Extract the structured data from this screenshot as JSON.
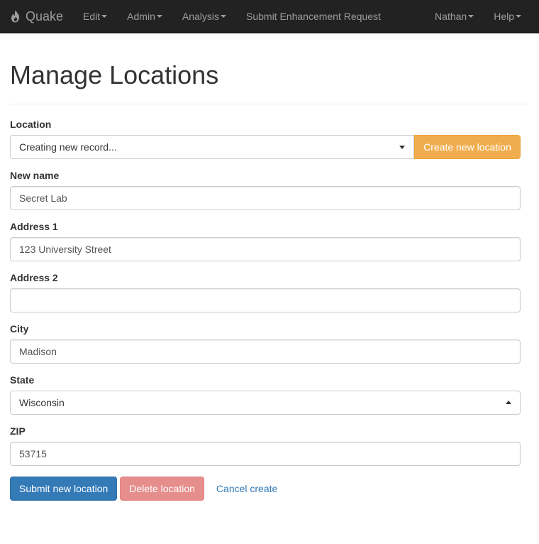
{
  "navbar": {
    "brand": "Quake",
    "items": [
      {
        "label": "Edit"
      },
      {
        "label": "Admin"
      },
      {
        "label": "Analysis"
      },
      {
        "label": "Submit Enhancement Request"
      }
    ],
    "right_items": [
      {
        "label": "Nathan"
      },
      {
        "label": "Help"
      }
    ]
  },
  "page": {
    "title": "Manage Locations"
  },
  "form": {
    "location": {
      "label": "Location",
      "value": "Creating new record...",
      "create_button": "Create new location"
    },
    "new_name": {
      "label": "New name",
      "value": "Secret Lab"
    },
    "address1": {
      "label": "Address 1",
      "value": "123 University Street"
    },
    "address2": {
      "label": "Address 2",
      "value": ""
    },
    "city": {
      "label": "City",
      "value": "Madison"
    },
    "state": {
      "label": "State",
      "value": "Wisconsin"
    },
    "zip": {
      "label": "ZIP",
      "value": "53715"
    },
    "actions": {
      "submit": "Submit new location",
      "delete": "Delete location",
      "cancel": "Cancel create"
    }
  },
  "colors": {
    "navbar_bg": "#222222",
    "primary": "#337ab7",
    "warning": "#f0ad4e",
    "danger": "#d9534f"
  }
}
